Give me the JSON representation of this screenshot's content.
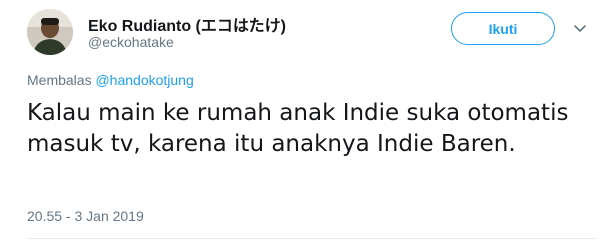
{
  "user": {
    "display_name": "Eko Rudianto (エコはたけ)",
    "handle": "@eckohatake"
  },
  "follow_button": {
    "label": "Ikuti"
  },
  "menu": {
    "icon": "chevron-down-icon"
  },
  "reply": {
    "prefix": "Membalas ",
    "mention": "@handokotjung"
  },
  "tweet": {
    "text": "Kalau main ke rumah anak Indie suka otomatis masuk tv, karena itu anaknya Indie Baren.",
    "timestamp": "20.55 - 3 Jan 2019"
  },
  "colors": {
    "accent": "#1da1f2",
    "secondary_text": "#657786",
    "primary_text": "#14171a"
  }
}
